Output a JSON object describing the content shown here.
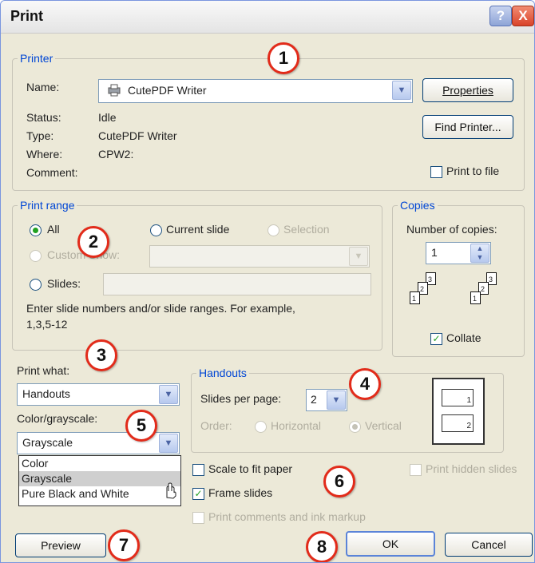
{
  "dialog": {
    "title": "Print",
    "help": "?",
    "close": "X"
  },
  "printer": {
    "legend": "Printer",
    "name_label": "Name:",
    "name_value": "CutePDF Writer",
    "status_label": "Status:",
    "status_value": "Idle",
    "type_label": "Type:",
    "type_value": "CutePDF Writer",
    "where_label": "Where:",
    "where_value": "CPW2:",
    "comment_label": "Comment:",
    "properties_button": "Properties",
    "find_printer_button": "Find Printer...",
    "print_to_file": "Print to file"
  },
  "print_range": {
    "legend": "Print range",
    "all": "All",
    "current_slide": "Current slide",
    "selection": "Selection",
    "custom_show": "Custom Show:",
    "slides": "Slides:",
    "hint": "Enter slide numbers and/or slide ranges. For example,",
    "hint2": "1,3,5-12"
  },
  "copies": {
    "legend": "Copies",
    "number_label": "Number of copies:",
    "number_value": "1",
    "collate": "Collate"
  },
  "print_what": {
    "label": "Print what:",
    "value": "Handouts"
  },
  "color_grayscale": {
    "label": "Color/grayscale:",
    "value": "Grayscale",
    "options": [
      "Color",
      "Grayscale",
      "Pure Black and White"
    ]
  },
  "handouts": {
    "legend": "Handouts",
    "slides_per_page_label": "Slides per page:",
    "slides_per_page_value": "2",
    "order_label": "Order:",
    "horizontal": "Horizontal",
    "vertical": "Vertical",
    "preview_numbers": [
      "1",
      "2"
    ]
  },
  "options": {
    "scale_to_fit": "Scale to fit paper",
    "frame_slides": "Frame slides",
    "print_comments": "Print comments and ink markup",
    "print_hidden": "Print hidden slides"
  },
  "buttons": {
    "preview": "Preview",
    "ok": "OK",
    "cancel": "Cancel"
  },
  "markers": [
    "1",
    "2",
    "3",
    "4",
    "5",
    "6",
    "7",
    "8"
  ],
  "collate_numbers": [
    "1",
    "2",
    "3"
  ],
  "colors": {
    "accent": "#0046d5",
    "marker_ring": "#e22b1a",
    "check": "#21a121"
  }
}
